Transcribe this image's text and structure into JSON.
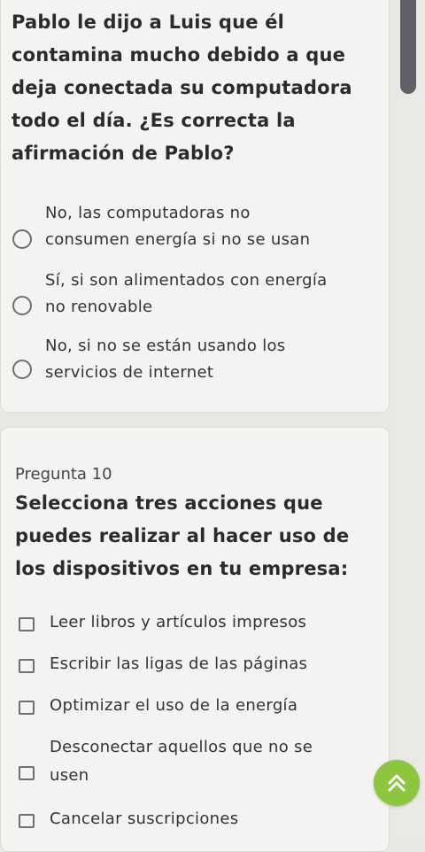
{
  "question1": {
    "lines": [
      "Pablo le dijo a Luis que él",
      "contamina mucho debido a que",
      "deja conectada su computadora",
      "todo el día. ¿Es correcta la",
      "afirmación de Pablo?"
    ],
    "options": [
      {
        "lines": [
          "No, las computadoras no",
          "consumen energía si no se usan"
        ]
      },
      {
        "lines": [
          "Sí, si son alimentados con energía",
          "no renovable"
        ]
      },
      {
        "lines": [
          "No, si no se están usando los",
          "servicios de internet"
        ]
      }
    ]
  },
  "question2": {
    "number_label": "Pregunta 10",
    "lines": [
      "Selecciona tres acciones que",
      "puedes realizar al hacer uso de",
      "los dispositivos en tu empresa:"
    ],
    "options": [
      {
        "lines": [
          "Leer libros y artículos impresos"
        ]
      },
      {
        "lines": [
          "Escribir las ligas de las páginas"
        ]
      },
      {
        "lines": [
          "Optimizar el uso de la energía"
        ]
      },
      {
        "lines": [
          "Desconectar aquellos que no se",
          "usen"
        ]
      },
      {
        "lines": [
          "Cancelar suscripciones"
        ]
      }
    ]
  },
  "colors": {
    "fab": "#8cc63f",
    "scroll_thumb": "#5f6065"
  },
  "icons": {
    "fab": "double-chevron-up-icon"
  }
}
